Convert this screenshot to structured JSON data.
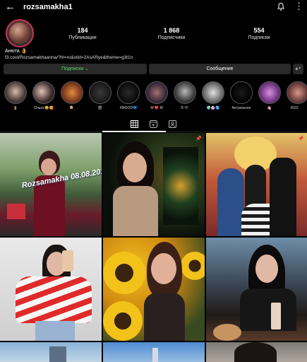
{
  "header": {
    "back_icon": "arrow-left-icon",
    "username": "rozsamakha1",
    "notifications_icon": "bell-icon",
    "more_icon": "more-vertical-icon"
  },
  "stats": [
    {
      "value": "184",
      "label": "Публикации"
    },
    {
      "value": "1 868",
      "label": "Подписчики"
    },
    {
      "value": "554",
      "label": "Подписки"
    }
  ],
  "bio": {
    "name": "Анюта 👌",
    "link": "f3.cool/Rozsamakhaanna/?hl=ru&stid=2AsARye&theme=g3t1n"
  },
  "buttons": {
    "subscribed": "Подписки ⌄",
    "message": "Сообщение",
    "add_user": "+⁺"
  },
  "highlights": [
    {
      "label": "👌"
    },
    {
      "label": "Ольга 😂🥰"
    },
    {
      "label": "🍭"
    },
    {
      "label": "🎬"
    },
    {
      "label": "#MOOD💙"
    },
    {
      "label": "M ❤️ M"
    },
    {
      "label": "R 🖤"
    },
    {
      "label": "🌍🌸🌎"
    },
    {
      "label": "Актуальное"
    },
    {
      "label": "🦄"
    },
    {
      "label": "2022"
    }
  ],
  "tabs": [
    {
      "name": "grid-icon"
    },
    {
      "name": "reels-icon"
    },
    {
      "name": "tagged-icon"
    }
  ],
  "posts": [
    {
      "text": "Rozsamakha 08.08.2018",
      "pinned": false
    },
    {
      "text": "",
      "pinned": true
    },
    {
      "text": "",
      "pinned": true
    },
    {
      "text": "",
      "pinned": false
    },
    {
      "text": "",
      "pinned": false
    },
    {
      "text": "",
      "pinned": false
    }
  ],
  "colors": {
    "accent_green": "#5fd16a",
    "avatar_ring": "#c9345b",
    "background": "#000000"
  }
}
